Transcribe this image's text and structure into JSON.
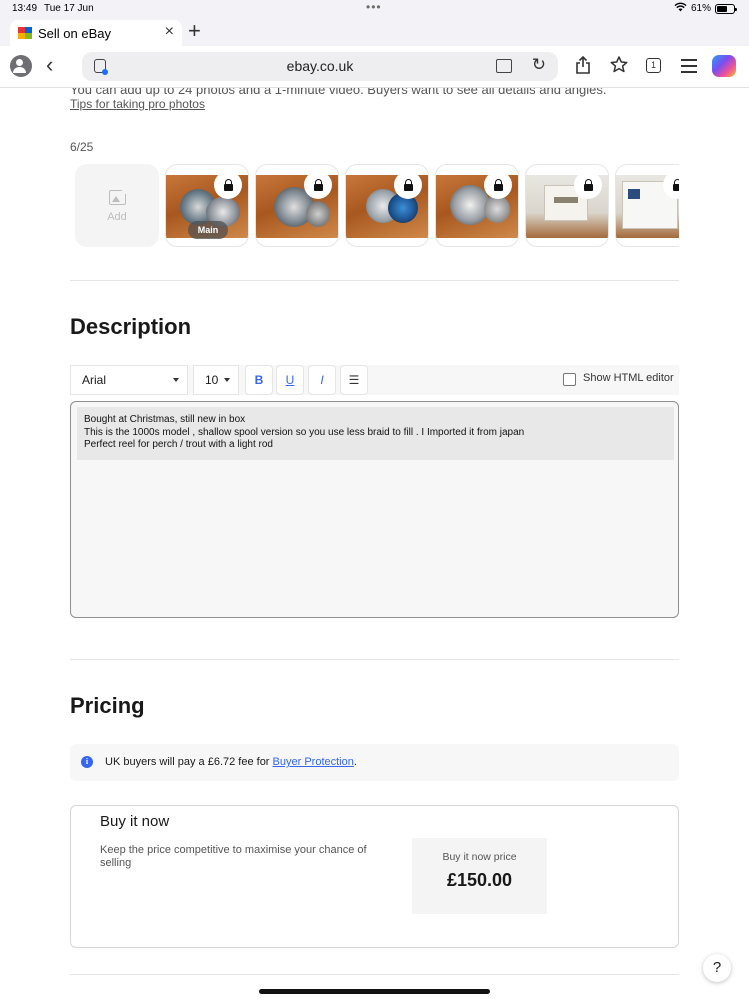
{
  "status_bar": {
    "time": "13:49",
    "date": "Tue 17 Jun",
    "battery": "61%",
    "battery_level": 0.61
  },
  "browser": {
    "tab_title": "Sell on eBay",
    "url": "ebay.co.uk",
    "tabs_count": "1",
    "icons": [
      "profile-icon",
      "back-icon",
      "lock-icon",
      "reader-icon",
      "reload-icon",
      "share-icon",
      "bookmark-star-icon",
      "tabs-icon",
      "menu-icon",
      "copilot-icon"
    ]
  },
  "photos": {
    "hint": "You can add up to 24 photos and a 1-minute video. Buyers want to see all details and angles.",
    "tips_link": "Tips for taking pro photos",
    "count": "6/25",
    "add_label": "Add",
    "main_badge": "Main"
  },
  "description": {
    "heading": "Description",
    "font_family": "Arial",
    "font_size": "10",
    "bold": "B",
    "underline": "U",
    "italic": "I",
    "html_editor_label": "Show HTML editor",
    "lines": [
      "Bought at Christmas, still new in box",
      "This is the 1000s model , shallow spool version so you use less braid to fill . I Imported it from japan",
      "Perfect reel for perch / trout with a light rod"
    ]
  },
  "pricing": {
    "heading": "Pricing",
    "notice_prefix": "UK buyers will pay a £6.72 fee for ",
    "notice_link": "Buyer Protection",
    "notice_suffix": ".",
    "buy_it_now": {
      "title": "Buy it now",
      "description": "Keep the price competitive to maximise your chance of selling",
      "price_label": "Buy it now price",
      "price": "£150.00"
    }
  },
  "help": "?",
  "colors": {
    "accent": "#3665f3",
    "text": "#191919",
    "muted": "#555555"
  }
}
